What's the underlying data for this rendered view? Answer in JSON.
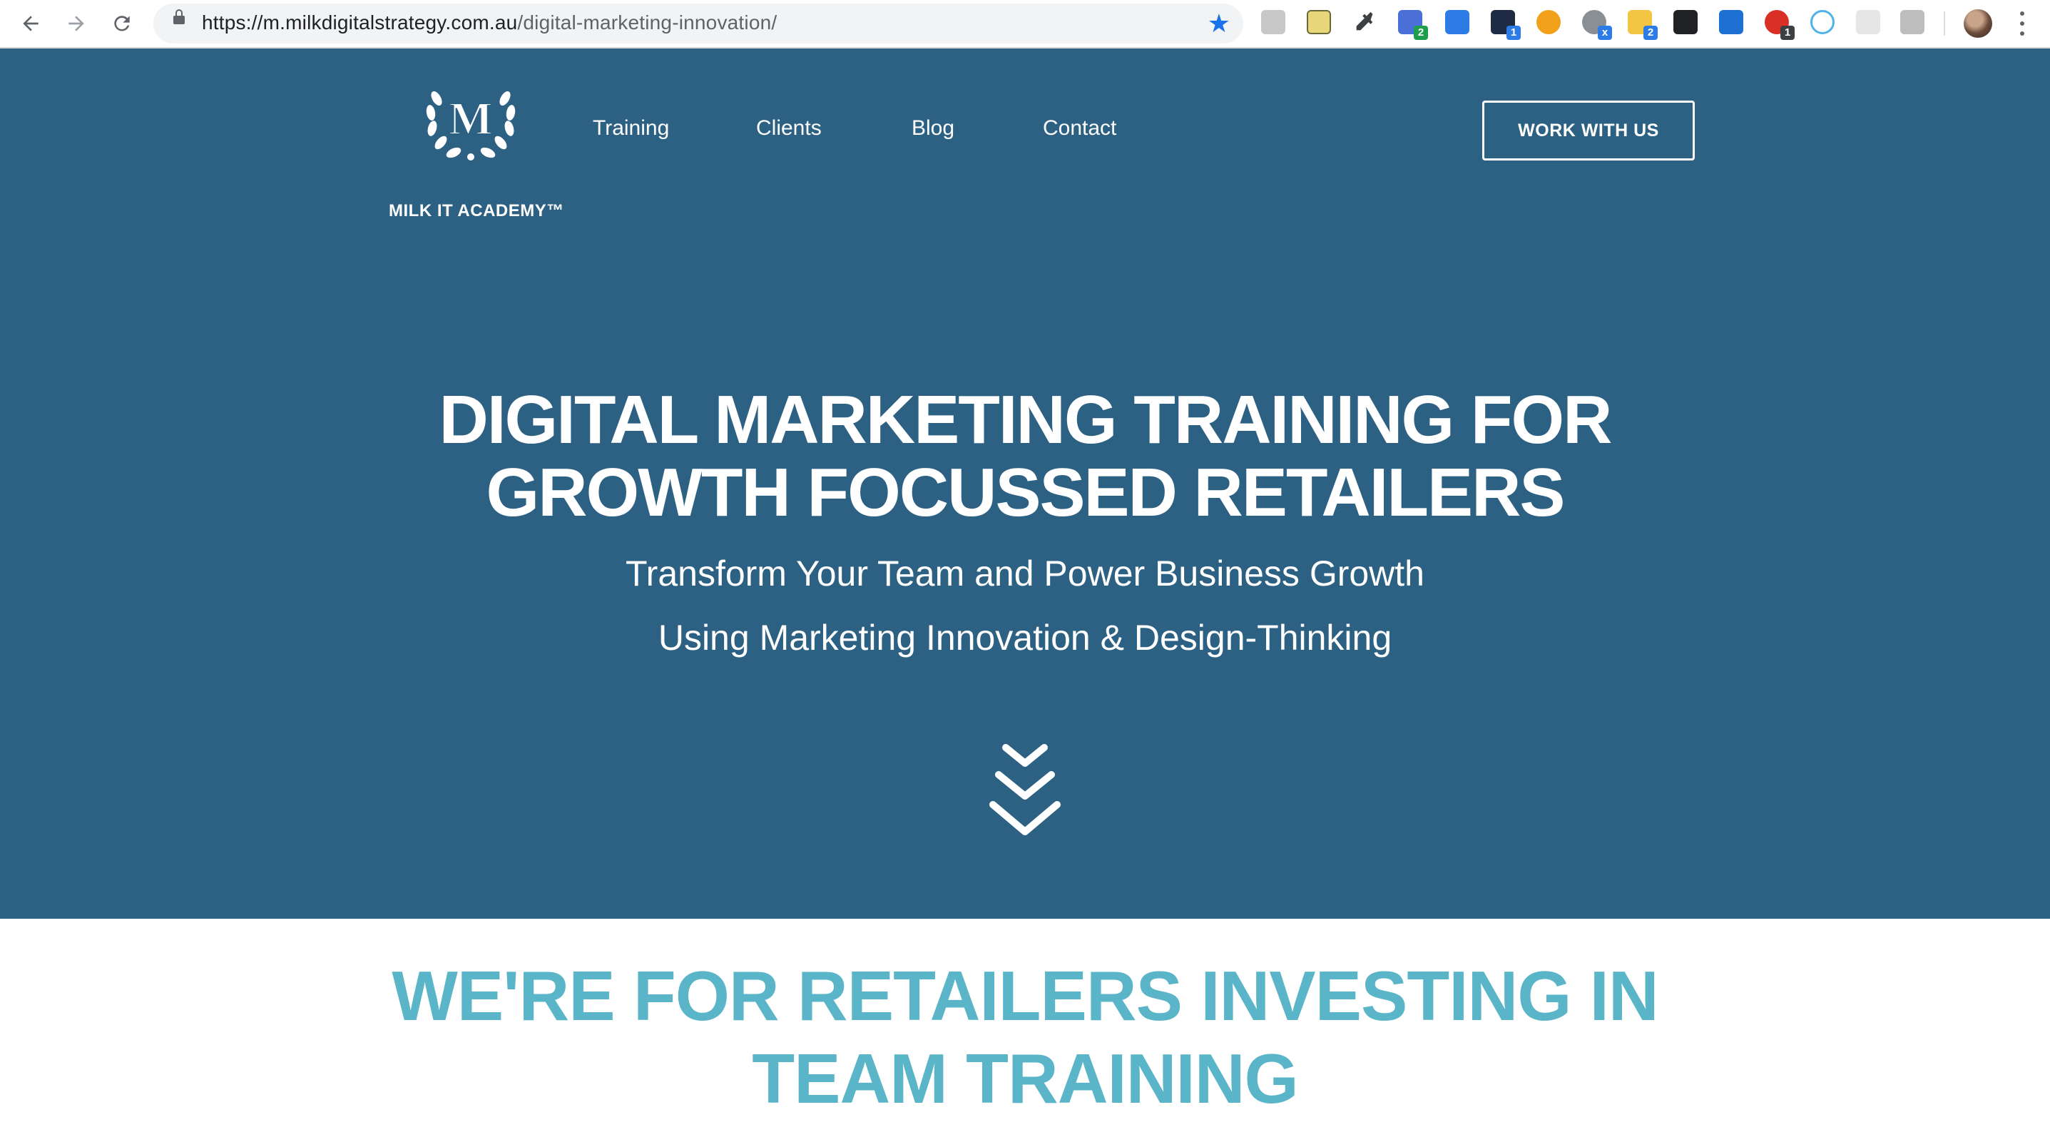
{
  "browser": {
    "url_host": "https://m.milkdigitalstrategy.com.au",
    "url_path": "/digital-marketing-innovation/",
    "extension_badges": [
      "2",
      "1",
      "x",
      "2",
      "1"
    ]
  },
  "site": {
    "logo_text": "MILK IT ACADEMY™",
    "logo_letter": "M",
    "nav": [
      "Training",
      "Clients",
      "Blog",
      "Contact"
    ],
    "cta": "WORK WITH US"
  },
  "hero": {
    "title_line1": "DIGITAL MARKETING TRAINING FOR",
    "title_line2": "GROWTH FOCUSSED RETAILERS",
    "subtitle_line1": "Transform Your Team and Power Business Growth",
    "subtitle_line2": "Using Marketing Innovation & Design-Thinking"
  },
  "section": {
    "title_line1": "WE'RE FOR RETAILERS INVESTING IN",
    "title_line2": "TEAM TRAINING"
  },
  "colors": {
    "hero_bg": "#2d6183",
    "section_title": "#5ab5c8",
    "accent_star": "#1a73e8"
  }
}
